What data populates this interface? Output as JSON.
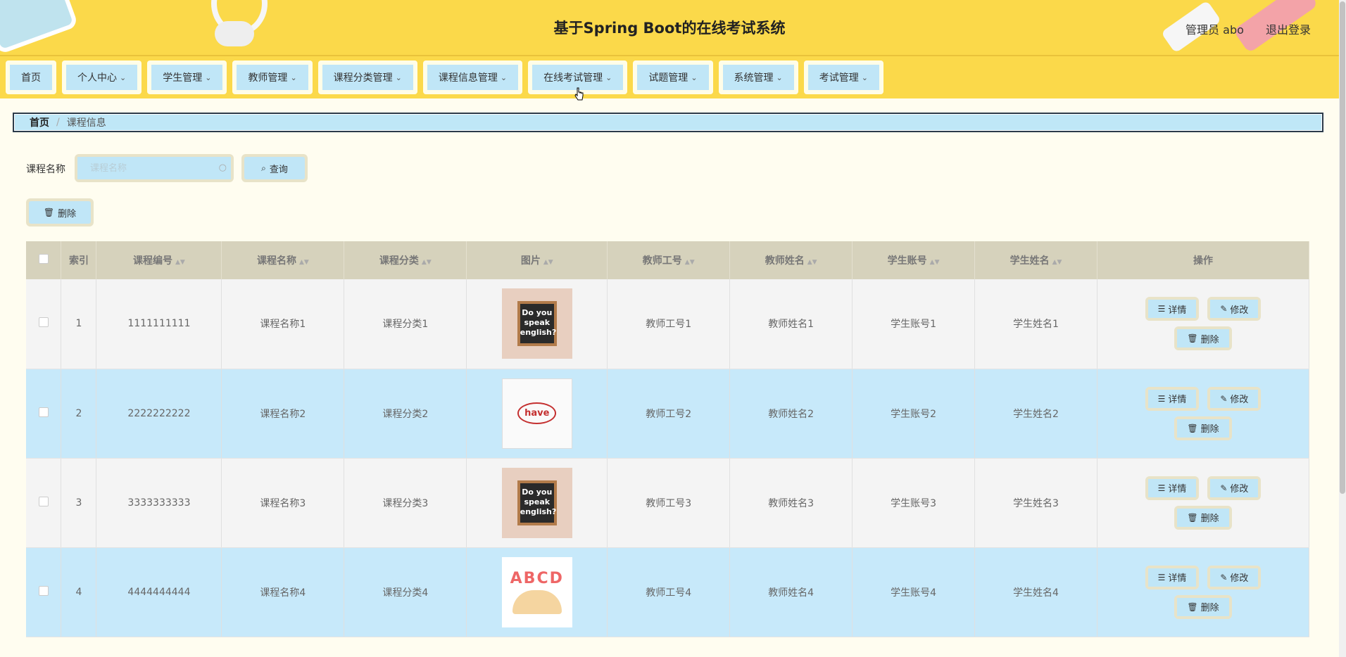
{
  "header": {
    "title": "基于Spring Boot的在线考试系统",
    "user_label": "管理员 abo",
    "logout": "退出登录"
  },
  "nav": [
    {
      "label": "首页",
      "has_menu": false
    },
    {
      "label": "个人中心",
      "has_menu": true
    },
    {
      "label": "学生管理",
      "has_menu": true
    },
    {
      "label": "教师管理",
      "has_menu": true
    },
    {
      "label": "课程分类管理",
      "has_menu": true
    },
    {
      "label": "课程信息管理",
      "has_menu": true
    },
    {
      "label": "在线考试管理",
      "has_menu": true
    },
    {
      "label": "试题管理",
      "has_menu": true
    },
    {
      "label": "系统管理",
      "has_menu": true
    },
    {
      "label": "考试管理",
      "has_menu": true
    }
  ],
  "breadcrumb": {
    "home": "首页",
    "sep": "/",
    "current": "课程信息"
  },
  "search": {
    "label": "课程名称",
    "placeholder": "课程名称",
    "button": "查询"
  },
  "bulk_delete": "删除",
  "table": {
    "headers": [
      "索引",
      "课程编号",
      "课程名称",
      "课程分类",
      "图片",
      "教师工号",
      "教师姓名",
      "学生账号",
      "学生姓名",
      "操作"
    ],
    "rows": [
      {
        "index": "1",
        "code": "1111111111",
        "name": "课程名称1",
        "category": "课程分类1",
        "image": "chalkboard",
        "board_text": "Do you speak english?",
        "teacher_no": "教师工号1",
        "teacher_name": "教师姓名1",
        "student_no": "学生账号1",
        "student_name": "学生姓名1"
      },
      {
        "index": "2",
        "code": "2222222222",
        "name": "课程名称2",
        "category": "课程分类2",
        "image": "mindmap",
        "board_text": "have",
        "teacher_no": "教师工号2",
        "teacher_name": "教师姓名2",
        "student_no": "学生账号2",
        "student_name": "学生姓名2"
      },
      {
        "index": "3",
        "code": "3333333333",
        "name": "课程名称3",
        "category": "课程分类3",
        "image": "chalkboard",
        "board_text": "Do you speak english?",
        "teacher_no": "教师工号3",
        "teacher_name": "教师姓名3",
        "student_no": "学生账号3",
        "student_name": "学生姓名3"
      },
      {
        "index": "4",
        "code": "4444444444",
        "name": "课程名称4",
        "category": "课程分类4",
        "image": "abc",
        "board_text": "ABCD",
        "teacher_no": "教师工号4",
        "teacher_name": "教师姓名4",
        "student_no": "学生账号4",
        "student_name": "学生姓名4"
      }
    ],
    "actions": {
      "detail": "详情",
      "edit": "修改",
      "delete": "删除"
    }
  },
  "colors": {
    "header_bg": "#fbd94a",
    "button_bg": "#c0e6f7",
    "row_alt": "#c7e9fa",
    "header_row": "#d6d2bc"
  }
}
